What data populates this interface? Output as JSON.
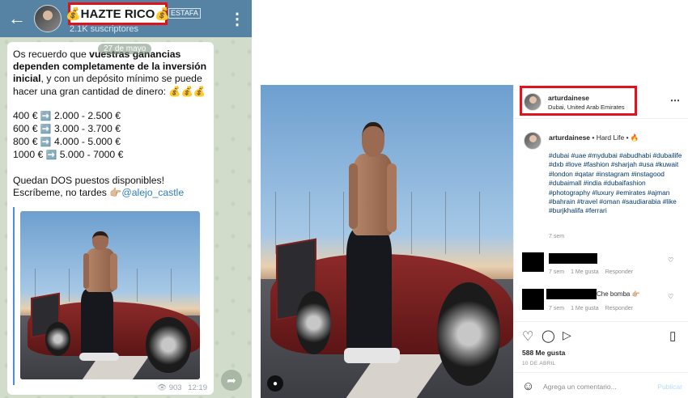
{
  "telegram": {
    "back_icon": "arrow-left-icon",
    "title": "💰HAZTE RICO💰",
    "tag": "ESTAFA",
    "subscribers": "2.1K suscriptores",
    "menu_icon": "more-vertical-icon",
    "date_chip": "27 de mayo",
    "message": {
      "intro_plain_1": "Os recuerdo que ",
      "intro_bold": "vuestras ganancias dependen completamente de la inversión inicial",
      "intro_plain_2": ", y con un depósito mínimo se puede hacer una gran cantidad de dinero: 💰💰💰",
      "rows": [
        {
          "from": "400 €",
          "arrow": "➡️",
          "to": "2.000 - 2.500 €"
        },
        {
          "from": "600 €",
          "arrow": "➡️",
          "to": "3.000 - 3.700 €"
        },
        {
          "from": "800 €",
          "arrow": "➡️",
          "to": "4.000 - 5.000 €"
        },
        {
          "from": "1000 €",
          "arrow": "➡️",
          "to": "5.000 - 7000 €"
        }
      ],
      "cta_line_1": "Quedan DOS puestos disponibles!",
      "cta_line_2": "Escríbeme, no tardes 👉🏼",
      "handle": "@alejo_castle"
    },
    "views": "903",
    "time": "12:19",
    "view_icon": "eye-icon",
    "forward_icon": "share-icon"
  },
  "instagram": {
    "username": "arturdainese",
    "location": "Dubai, United Arab Emirates",
    "more_icon": "more-horizontal-icon",
    "caption_user": "arturdainese",
    "caption_text": " • Hard Life • 🔥",
    "hashtags": "#dubai #uae #mydubai #abudhabi #dubailife #dxb #love #fashion #sharjah #usa #kuwait #london #qatar #instagram #instagood #dubaimall #india #dubaifashion #photography #luxury #emirates #ajman #bahrain #travel #oman #saudiarabia #like #burjkhalifa #ferrari",
    "caption_age": "7 sem",
    "comments": [
      {
        "text": "",
        "age": "7 sem",
        "likes": "1 Me gusta",
        "reply": "Responder"
      },
      {
        "text": "Che bomba 👉🏼",
        "age": "7 sem",
        "likes": "1 Me gusta",
        "reply": "Responder"
      }
    ],
    "likes_count": "588 Me gusta",
    "post_date": "10 DE ABRIL",
    "add_comment_placeholder": "Agrega un comentario...",
    "publish_label": "Publicar",
    "icons": {
      "like": "heart-icon",
      "comment": "comment-icon",
      "share": "send-icon",
      "save": "bookmark-icon",
      "emoji": "smile-icon",
      "user_tag": "user-icon"
    }
  },
  "colors": {
    "telegram_header": "#5682a3",
    "highlight_red": "#e0121c",
    "link_blue": "#2f7dc2",
    "ig_tag_blue": "#00376b"
  }
}
